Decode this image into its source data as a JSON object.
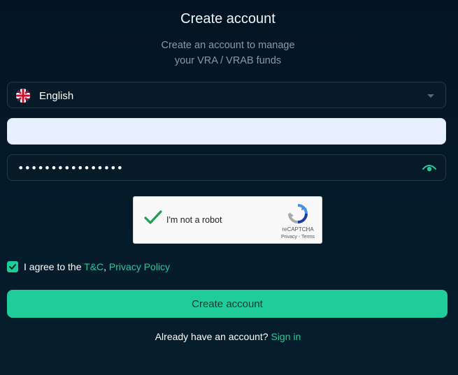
{
  "header": {
    "title": "Create account",
    "subtitle_line1": "Create an account to manage",
    "subtitle_line2": "your VRA / VRAB funds"
  },
  "language": {
    "selected": "English",
    "flag_icon": "uk-flag-icon"
  },
  "email": {
    "value": "",
    "placeholder": ""
  },
  "password": {
    "masked_value": "••••••••••••••••",
    "toggle_icon": "eye-icon"
  },
  "recaptcha": {
    "label": "I'm not a robot",
    "brand": "reCAPTCHA",
    "links": "Privacy - Terms",
    "checked": true
  },
  "agreement": {
    "prefix": "I agree to the ",
    "tc_link": "T&C",
    "separator": ", ",
    "privacy_link": "Privacy Policy",
    "checked": true
  },
  "actions": {
    "create_label": "Create account"
  },
  "footer": {
    "prompt": "Already have an account? ",
    "signin_link": "Sign in"
  },
  "colors": {
    "accent": "#21cc9b",
    "background": "#031322",
    "field_border": "#24394a"
  }
}
